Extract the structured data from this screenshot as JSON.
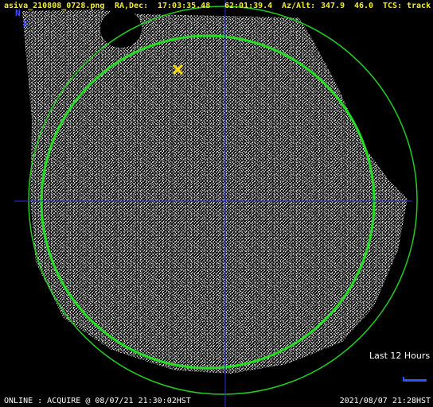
{
  "header": {
    "filename": "asiva_210808_0728.png",
    "ra_dec_label": "RA,Dec:",
    "ra": "17:03:35.48",
    "dec": "62:01:39.4",
    "az_alt_label": "Az/Alt:",
    "az": "347.9",
    "alt": "46.0",
    "tcs_label": "TCS:",
    "tcs_state": "track"
  },
  "compass": {
    "north": "N",
    "east": "E"
  },
  "legend": {
    "label": "Last 12 Hours"
  },
  "footer": {
    "status": "ONLINE : ACQUIRE @ 08/07/21 21:30:02HST",
    "timestamp": "2021/08/07 21:28HST"
  },
  "colors": {
    "header_text": "#f2ee2a",
    "compass": "#3a4cff",
    "crosshair": "#2233dd",
    "horizon_circle": "#22cc22",
    "elevation_circle": "#22dd22",
    "telescope_marker": "#ffdd00",
    "track_line": "#2a56ff"
  },
  "icons": {
    "telescope_marker": "x-marker-icon"
  }
}
